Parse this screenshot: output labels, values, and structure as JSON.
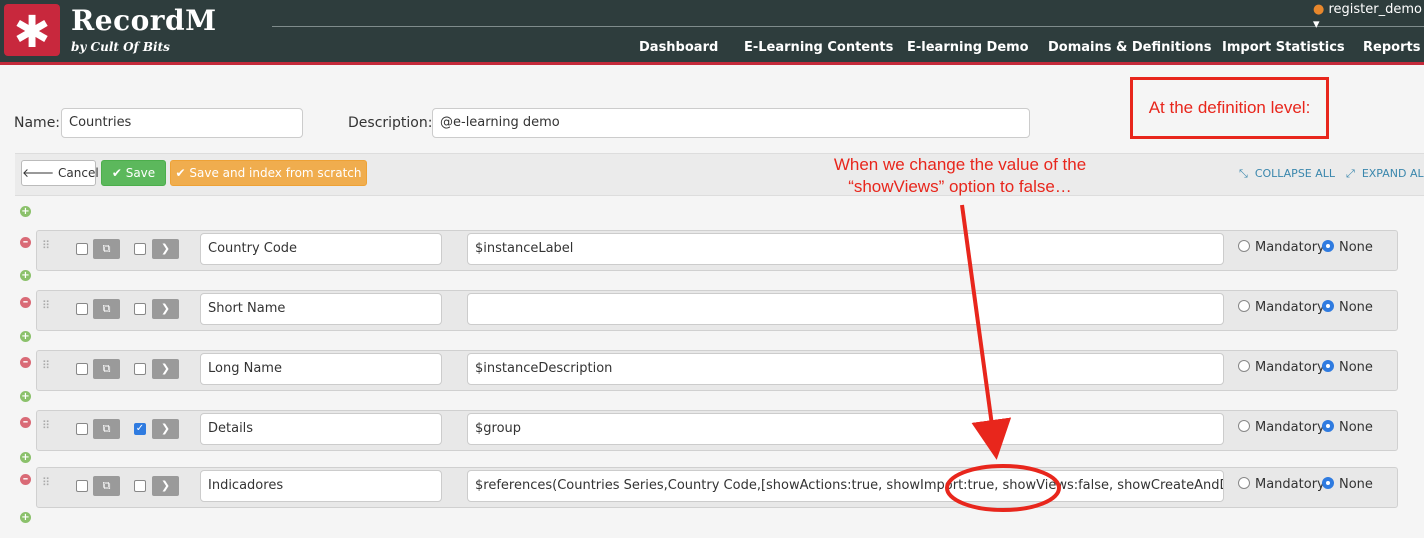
{
  "header": {
    "brand": "RecordM",
    "brand_sub": "by Cult Of Bits",
    "user": "register_demo",
    "nav": [
      "Dashboard",
      "E-Learning Contents",
      "E-learning Demo",
      "Domains & Definitions",
      "Import Statistics",
      "Reports"
    ]
  },
  "form": {
    "name_label": "Name:",
    "name_value": "Countries",
    "description_label": "Description:",
    "description_value": "@e-learning demo"
  },
  "toolbar": {
    "cancel_label": "Cancel",
    "save_label": "Save",
    "save_index_label": "Save and index from scratch",
    "collapse_all": "COLLAPSE ALL",
    "expand_all": "EXPAND ALL"
  },
  "fields": [
    {
      "name": "Country Code",
      "description": "$instanceLabel",
      "checked": false
    },
    {
      "name": "Short Name",
      "description": "",
      "checked": false
    },
    {
      "name": "Long Name",
      "description": "$instanceDescription",
      "checked": false
    },
    {
      "name": "Details",
      "description": "$group",
      "checked": true
    },
    {
      "name": "Indicadores",
      "description": "$references(Countries Series,Country Code,[showActions:true, showImport:true, showViews:false, showCreateAndDelete:true",
      "checked": false
    }
  ],
  "radio_labels": {
    "mandatory": "Mandatory",
    "none": "None"
  },
  "annotations": {
    "box_text": "At the definition level:",
    "arrow_text_line1": "When we change the value of the",
    "arrow_text_line2": "“showViews” option to false…"
  },
  "colors": {
    "header_bg": "#2e3d3d",
    "accent_red": "#c8283d",
    "annotation_red": "#e8261c",
    "save_green": "#5cb85c",
    "save_index_orange": "#f0ad4e"
  }
}
